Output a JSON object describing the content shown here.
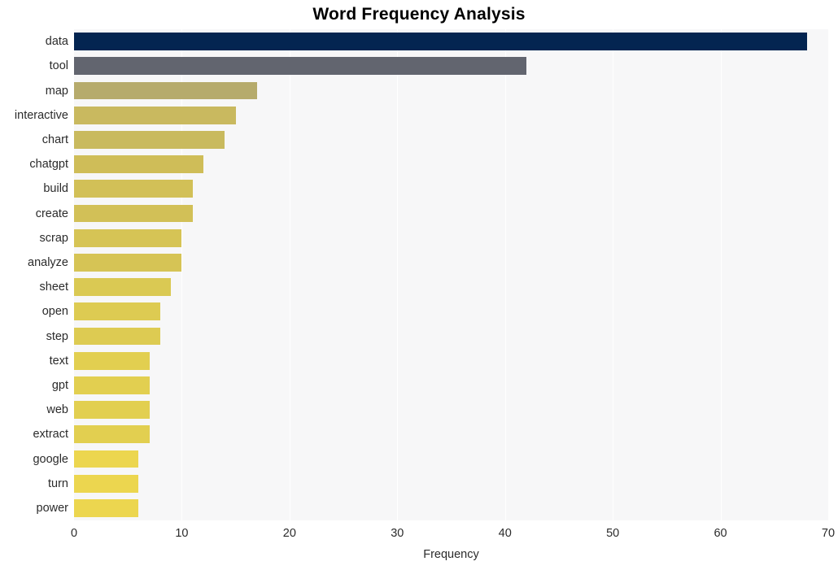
{
  "chart_data": {
    "type": "bar",
    "orientation": "horizontal",
    "title": "Word Frequency Analysis",
    "xlabel": "Frequency",
    "ylabel": "",
    "xlim": [
      0,
      70
    ],
    "ylim": [
      0,
      20
    ],
    "xticks": [
      "0",
      "10",
      "20",
      "30",
      "40",
      "50",
      "60",
      "70"
    ],
    "xtick_values": [
      0,
      10,
      20,
      30,
      40,
      50,
      60,
      70
    ],
    "grid": true,
    "grid_axis": "x",
    "legend": "none",
    "categories": [
      "data",
      "tool",
      "map",
      "interactive",
      "chart",
      "chatgpt",
      "build",
      "create",
      "scrap",
      "analyze",
      "sheet",
      "open",
      "step",
      "text",
      "gpt",
      "web",
      "extract",
      "google",
      "turn",
      "power"
    ],
    "values": [
      68,
      42,
      17,
      15,
      14,
      12,
      11,
      11,
      10,
      10,
      9,
      8,
      8,
      7,
      7,
      7,
      7,
      6,
      6,
      6
    ],
    "bar_colors": [
      "#042551",
      "#62656f",
      "#b6ab6c",
      "#c9b95f",
      "#c9ba5e",
      "#cfbd58",
      "#d2c057",
      "#d2c057",
      "#d6c455",
      "#d6c455",
      "#dac953",
      "#ddcb52",
      "#ddcb52",
      "#e2cf50",
      "#e2cf50",
      "#e2cf50",
      "#e2cf50",
      "#ecd64f",
      "#ecd64f",
      "#ecd64f"
    ],
    "plot_background": "#f7f7f8",
    "figure_background": "#ffffff",
    "gridline_color": "#ffffff"
  }
}
